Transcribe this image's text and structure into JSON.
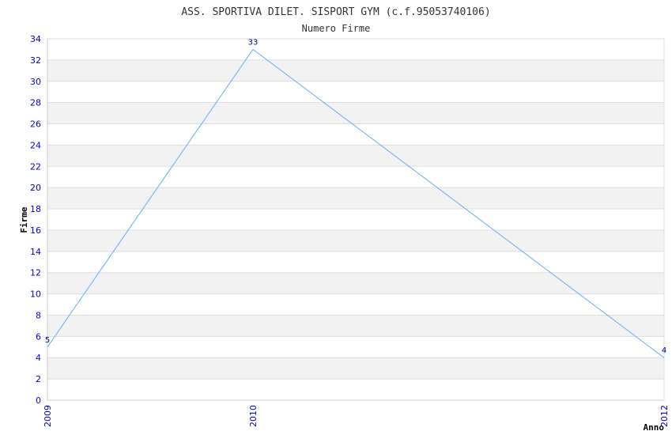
{
  "chart_data": {
    "type": "line",
    "title": "ASS. SPORTIVA DILET. SISPORT GYM (c.f.95053740106)",
    "subtitle": "Numero Firme",
    "xlabel": "Anno",
    "ylabel": "Firme",
    "x": [
      "2009",
      "2010",
      "2012"
    ],
    "y": [
      5,
      33,
      4
    ],
    "data_labels": [
      "5",
      "33",
      "4"
    ],
    "ylim": [
      0,
      34
    ],
    "yticks": [
      0,
      2,
      4,
      6,
      8,
      10,
      12,
      14,
      16,
      18,
      20,
      22,
      24,
      26,
      28,
      30,
      32,
      34
    ],
    "grid": true,
    "line_color": "#66aaff",
    "tick_color": "#0000cc",
    "band_color": "#f2f2f2"
  }
}
